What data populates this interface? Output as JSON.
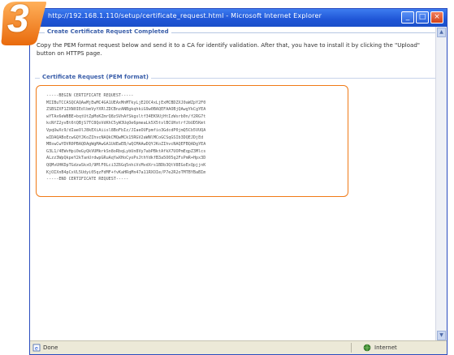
{
  "step_badge": {
    "number": "3",
    "color": "#f07a17"
  },
  "window": {
    "title": "http://192.168.1.110/setup/certificate_request.html - Microsoft Internet Explorer",
    "min_label": "_",
    "max_label": "□",
    "close_label": "×"
  },
  "section": {
    "title": "Create Certificate Request Completed",
    "description": "Copy the PEM format request below and send it to a CA for identify validation. After that, you have to install it by clicking the \"Upload\" button on HTTPS page.",
    "pem_title": "Certificate Request (PEM format)",
    "pem_lines": [
      "-----BEGIN CERTIFICATE REQUEST-----",
      "MIIBuTCCASQCAQAwMjEwMC4GA1UEAxMnMTkyLjE2OC4xLjExMCBDZXJ0aWZpY2F0",
      "ZSBSZXF1ZXN0IEdlbmVyYXRlZDCBnzANBgkqhkiG9w0BAQEFAAOBjQAwgYkCgYEA",
      "wYTAx6eW8BE+bqtUtZpMoKZmrQ8zSVhAfSkgsltf34EK9UjHtIzWsrb0n/f2RG7t",
      "kcNfZ2yvBt6tQBjS7TC8QoVdKhC5yW3UqOe6pmeaLk5X5tvlBCUHxtrfJbUD5Kmt",
      "VpqUwXc9/dIaeOlJ8kEXiAiisl8BoFbIz/JIaeOUFpmfio3GdcdP0jmQ5Cb5VUQA",
      "wIDAQABoEcwGQYJKoZIhvcNAQkCMQwMCk15RGV2aWNlMCoGCSqGSIb3DQEJDjEd",
      "MBswCwYDVR0PBAQDAgWgMAwGA1UdEwEB/wQCMAAwDQYJKoZIhvcNAQEFBQADgYEA",
      "G3L1/4EWvHpi0eGyQkVUMkrkSn8oRbqLybUn8Vy7abPBktAfkX7UOPmEqpZ3Mlcs",
      "ALzz3WpQkpeY2kTanUrdwpGRuAqYwXHoCyoPsJthYdkfB3a5O05q2FsPmR+Hpx3D",
      "QQMvUHKDpTGdzwSkxO/9MlF0Lci3Z6Gq5nhiVcMvdXrs1BDb3QtV8EGoExQpjjnK",
      "KjOIXnB4pCxVL5Udyi05qzFdMF+fvKaHRqMn47a11RXOIe/P7e2R2oTMTBYBaBIm",
      "-----END CERTIFICATE REQUEST-----"
    ]
  },
  "status": {
    "left": "Done",
    "zone": "Internet"
  }
}
